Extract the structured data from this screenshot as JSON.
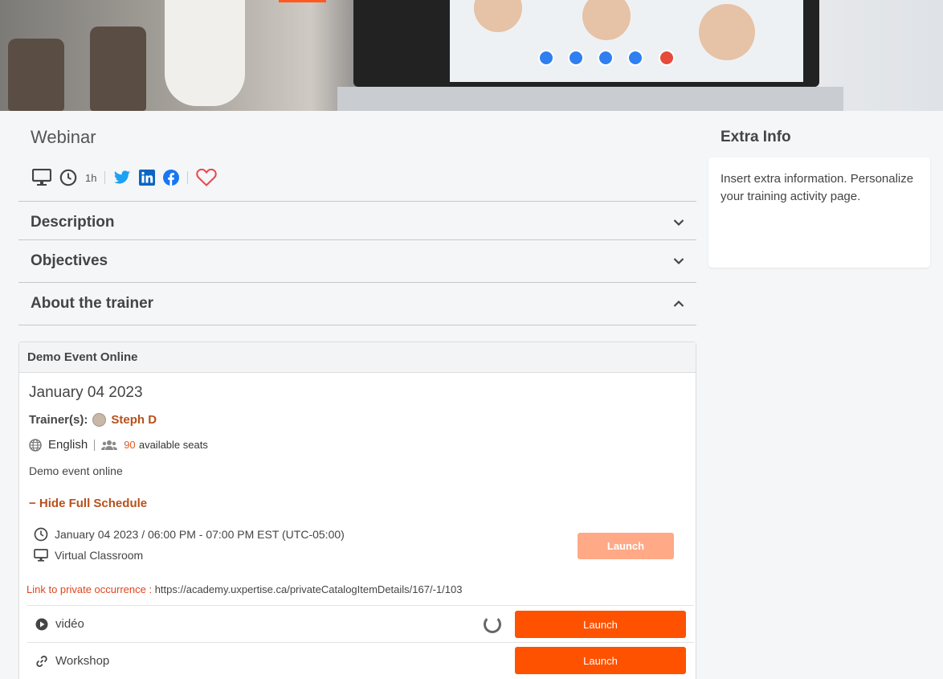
{
  "page": {
    "title": "Webinar",
    "duration": "1h"
  },
  "icons": {
    "format": "desktop-icon",
    "time": "clock-icon",
    "social": [
      "twitter-icon",
      "linkedin-icon",
      "facebook-icon"
    ],
    "favorite": "heart-icon"
  },
  "colors": {
    "accent": "#ff5200",
    "accent_light": "#ffa987",
    "link": "#b8501a",
    "twitter": "#1da1f2",
    "linkedin": "#0a66c2",
    "facebook": "#1877f2",
    "heart": "#e5484d"
  },
  "accordion": [
    {
      "label": "Description",
      "expanded": false
    },
    {
      "label": "Objectives",
      "expanded": false
    },
    {
      "label": "About the trainer",
      "expanded": true
    }
  ],
  "event": {
    "header": "Demo Event Online",
    "date": "January 04 2023",
    "trainer_label": "Trainer(s):",
    "trainer_name": "Steph D",
    "language": "English",
    "seats_count": "90",
    "seats_label": "available seats",
    "description": "Demo event online",
    "hide_schedule": "− Hide Full Schedule",
    "schedule_time": "January 04 2023 / 06:00 PM - 07:00 PM EST (UTC-05:00)",
    "schedule_room": "Virtual Classroom",
    "launch_disabled": "Launch",
    "private_link_label": "Link to private occurrence :",
    "private_link_url": "https://academy.uxpertise.ca/privateCatalogItemDetails/167/-1/103",
    "items": [
      {
        "name": "vidéo",
        "icon": "play-icon",
        "launch": "Launch"
      },
      {
        "name": "Workshop",
        "icon": "link-icon",
        "launch": "Launch"
      }
    ]
  },
  "sidebar": {
    "title": "Extra Info",
    "text": "Insert extra information. Personalize your training activity page."
  }
}
